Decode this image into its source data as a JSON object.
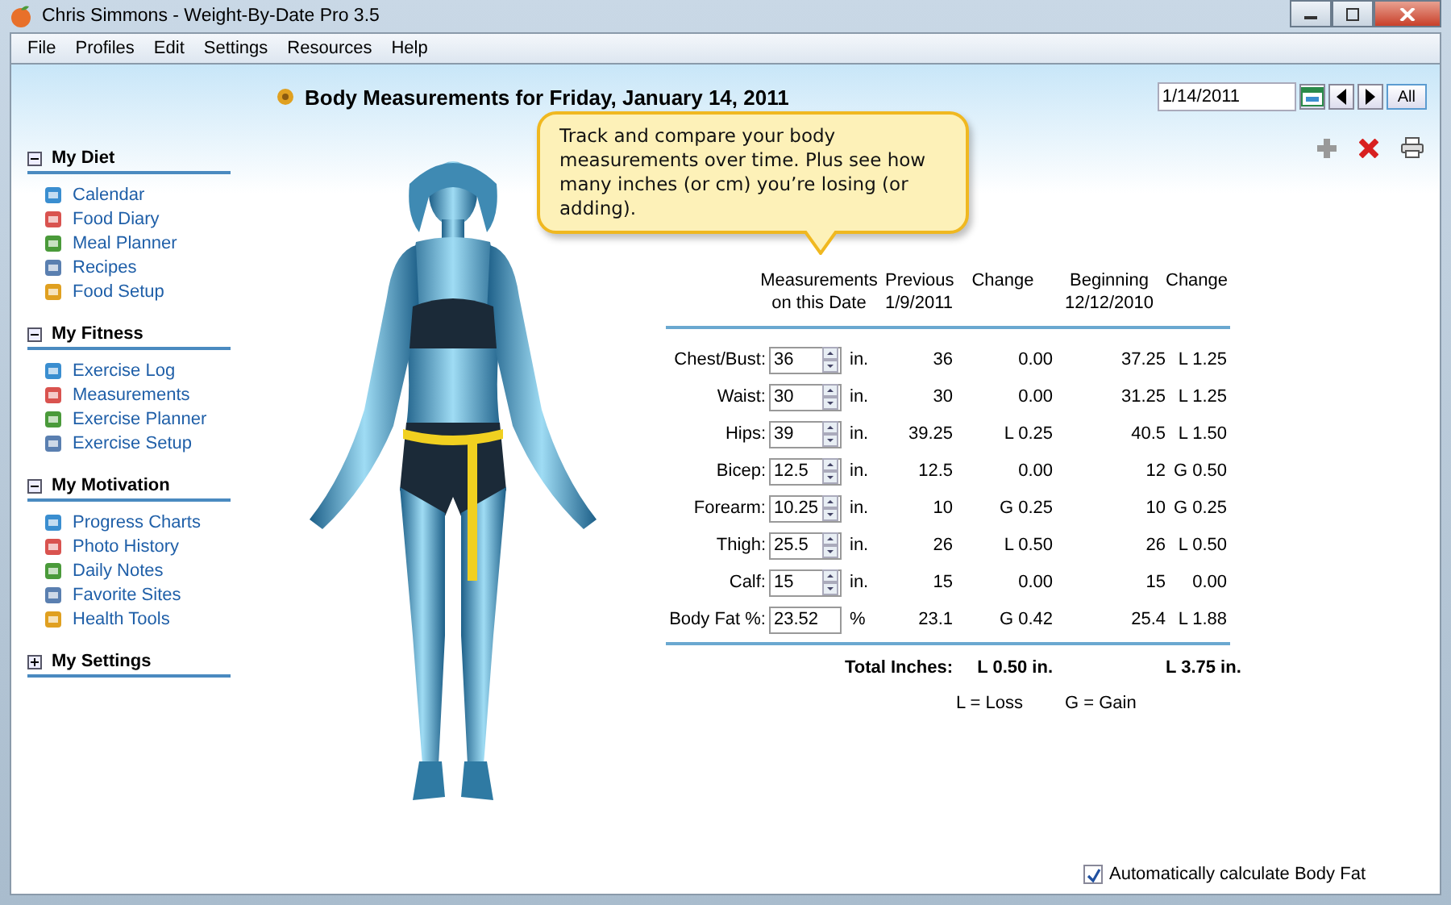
{
  "window": {
    "title": "Chris Simmons - Weight-By-Date Pro 3.5"
  },
  "menu": [
    "File",
    "Profiles",
    "Edit",
    "Settings",
    "Resources",
    "Help"
  ],
  "header": {
    "title": "Body Measurements for Friday, January 14, 2011"
  },
  "date_field": {
    "value": "1/14/2011",
    "button": "All"
  },
  "callout": "Track and compare your body measurements over time. Plus see how many inches (or cm) you’re losing (or adding).",
  "sidebar": {
    "sections": [
      {
        "title": "My Diet",
        "expanded": true,
        "items": [
          "Calendar",
          "Food Diary",
          "Meal Planner",
          "Recipes",
          "Food Setup"
        ]
      },
      {
        "title": "My Fitness",
        "expanded": true,
        "items": [
          "Exercise Log",
          "Measurements",
          "Exercise Planner",
          "Exercise Setup"
        ]
      },
      {
        "title": "My Motivation",
        "expanded": true,
        "items": [
          "Progress Charts",
          "Photo History",
          "Daily Notes",
          "Favorite Sites",
          "Health Tools"
        ]
      },
      {
        "title": "My Settings",
        "expanded": false
      }
    ]
  },
  "table": {
    "columns": [
      "Measurements\non this Date",
      "Previous\n1/9/2011",
      "Change",
      "Beginning\n12/12/2010",
      "Change"
    ],
    "rows": [
      {
        "label": "Chest/Bust:",
        "value": "36",
        "kind": "spinner",
        "unit": "in.",
        "previous": "36",
        "change": "0.00",
        "beginning": "37.25",
        "change_total": "L 1.25"
      },
      {
        "label": "Waist:",
        "value": "30",
        "kind": "spinner",
        "unit": "in.",
        "previous": "30",
        "change": "0.00",
        "beginning": "31.25",
        "change_total": "L 1.25"
      },
      {
        "label": "Hips:",
        "value": "39",
        "kind": "spinner",
        "unit": "in.",
        "previous": "39.25",
        "change": "L 0.25",
        "beginning": "40.5",
        "change_total": "L 1.50"
      },
      {
        "label": "Bicep:",
        "value": "12.5",
        "kind": "spinner",
        "unit": "in.",
        "previous": "12.5",
        "change": "0.00",
        "beginning": "12",
        "change_total": "G 0.50"
      },
      {
        "label": "Forearm:",
        "value": "10.25",
        "kind": "spinner",
        "unit": "in.",
        "previous": "10",
        "change": "G 0.25",
        "beginning": "10",
        "change_total": "G 0.25"
      },
      {
        "label": "Thigh:",
        "value": "25.5",
        "kind": "spinner",
        "unit": "in.",
        "previous": "26",
        "change": "L 0.50",
        "beginning": "26",
        "change_total": "L 0.50"
      },
      {
        "label": "Calf:",
        "value": "15",
        "kind": "spinner",
        "unit": "in.",
        "previous": "15",
        "change": "0.00",
        "beginning": "15",
        "change_total": "0.00"
      },
      {
        "label": "Body Fat %:",
        "value": "23.52",
        "kind": "plain",
        "unit": "%",
        "previous": "23.1",
        "change": "G 0.42",
        "beginning": "25.4",
        "change_total": "L 1.88"
      }
    ],
    "totals": {
      "label": "Total Inches:",
      "change": "L 0.50 in.",
      "change_total": "L 3.75 in."
    },
    "legend": [
      "L = Loss",
      "G = Gain"
    ]
  },
  "auto_body_fat": {
    "label": "Automatically calculate Body Fat",
    "checked": true
  }
}
